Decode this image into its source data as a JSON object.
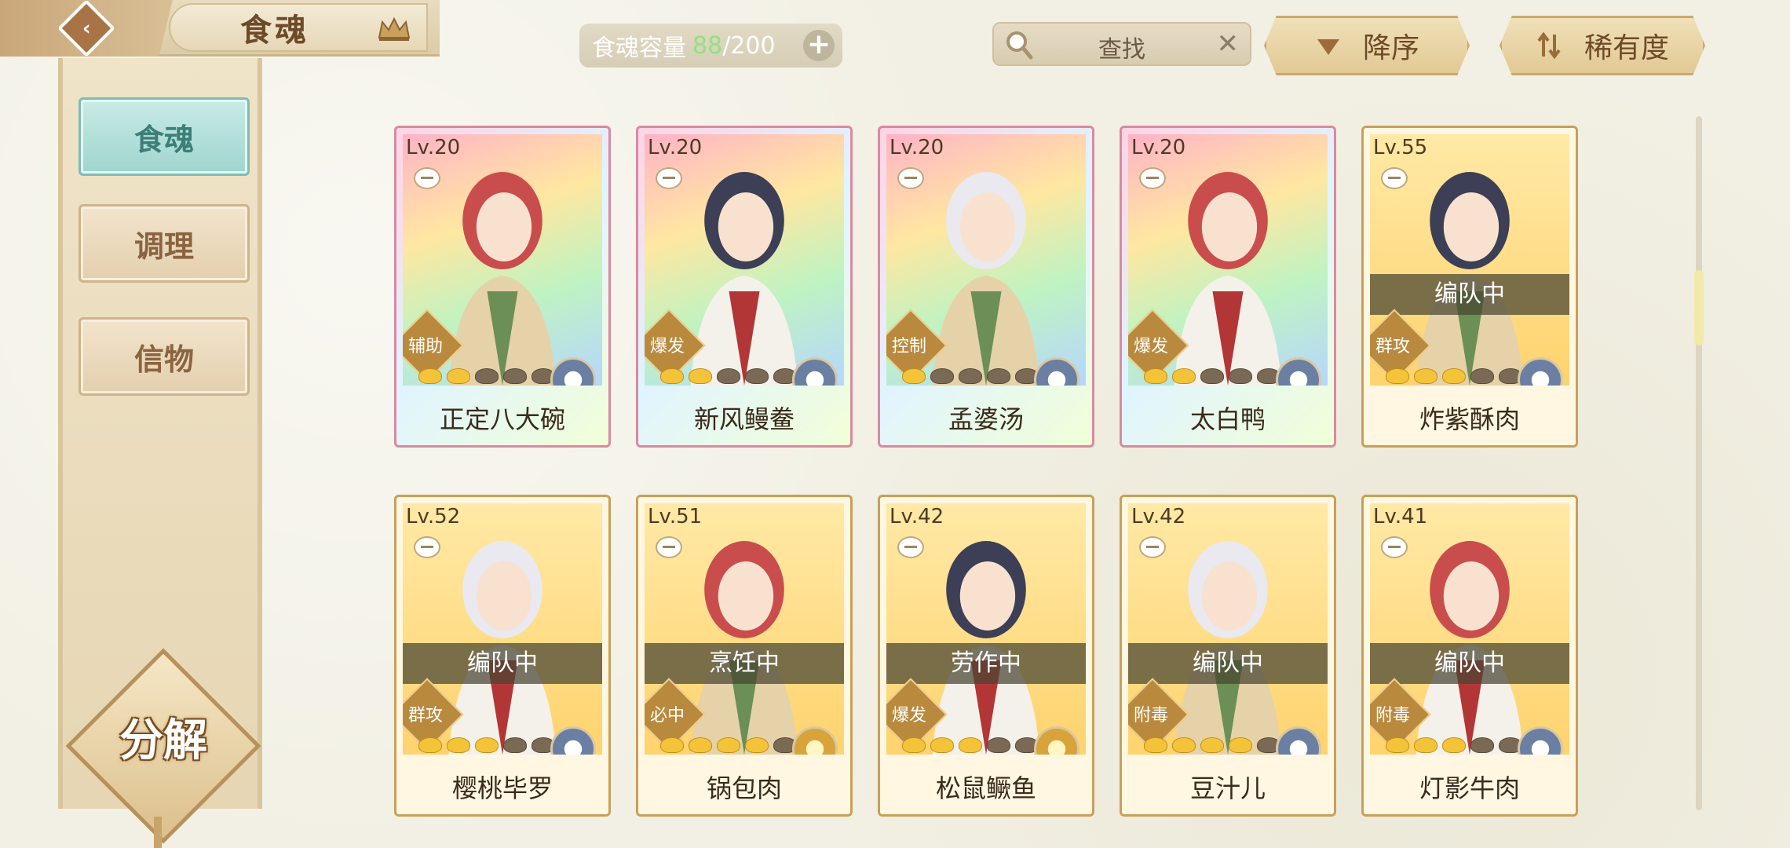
{
  "header": {
    "title": "食魂",
    "capacity_label": "食魂容量",
    "capacity_current": "88",
    "capacity_max": "/200",
    "capacity_add": "+",
    "search_label": "查找",
    "search_clear": "✕",
    "sort_order_label": "降序",
    "sort_by_label": "稀有度",
    "back_glyph": "‹"
  },
  "sidebar": {
    "items": [
      {
        "label": "食魂",
        "active": true
      },
      {
        "label": "调理",
        "active": false
      },
      {
        "label": "信物",
        "active": false
      }
    ],
    "decompose_label": "分解"
  },
  "colors": {
    "accent_teal": "#9fd5ce",
    "gold_border": "#c8a058",
    "capacity_green": "#8ee37e"
  },
  "cards": [
    {
      "level": "Lv.20",
      "name": "正定八大碗",
      "role": "辅助",
      "status": "",
      "rarity": "rainbow",
      "stars_on": 2,
      "stars_total": 6,
      "element": "blue-flower"
    },
    {
      "level": "Lv.20",
      "name": "新风鳗鲞",
      "role": "爆发",
      "status": "",
      "rarity": "rainbow",
      "stars_on": 2,
      "stars_total": 6,
      "element": "blue-flower"
    },
    {
      "level": "Lv.20",
      "name": "孟婆汤",
      "role": "控制",
      "status": "",
      "rarity": "rainbow",
      "stars_on": 1,
      "stars_total": 6,
      "element": "blue-flower"
    },
    {
      "level": "Lv.20",
      "name": "太白鸭",
      "role": "爆发",
      "status": "",
      "rarity": "rainbow",
      "stars_on": 2,
      "stars_total": 6,
      "element": "blue-flower"
    },
    {
      "level": "Lv.55",
      "name": "炸紫酥肉",
      "role": "群攻",
      "status": "编队中",
      "rarity": "gold",
      "stars_on": 3,
      "stars_total": 6,
      "element": "blue-flower"
    },
    {
      "level": "Lv.52",
      "name": "樱桃毕罗",
      "role": "群攻",
      "status": "编队中",
      "rarity": "gold",
      "stars_on": 3,
      "stars_total": 5,
      "element": "blue-flower"
    },
    {
      "level": "Lv.51",
      "name": "锅包肉",
      "role": "必中",
      "status": "烹饪中",
      "rarity": "gold",
      "stars_on": 4,
      "stars_total": 6,
      "element": "gold-flower"
    },
    {
      "level": "Lv.42",
      "name": "松鼠鳜鱼",
      "role": "爆发",
      "status": "劳作中",
      "rarity": "gold",
      "stars_on": 3,
      "stars_total": 5,
      "element": "gold-flower"
    },
    {
      "level": "Lv.42",
      "name": "豆汁儿",
      "role": "附毒",
      "status": "编队中",
      "rarity": "gold",
      "stars_on": 4,
      "stars_total": 6,
      "element": "blue-flower"
    },
    {
      "level": "Lv.41",
      "name": "灯影牛肉",
      "role": "附毒",
      "status": "编队中",
      "rarity": "gold",
      "stars_on": 3,
      "stars_total": 5,
      "element": "blue-flower"
    }
  ]
}
